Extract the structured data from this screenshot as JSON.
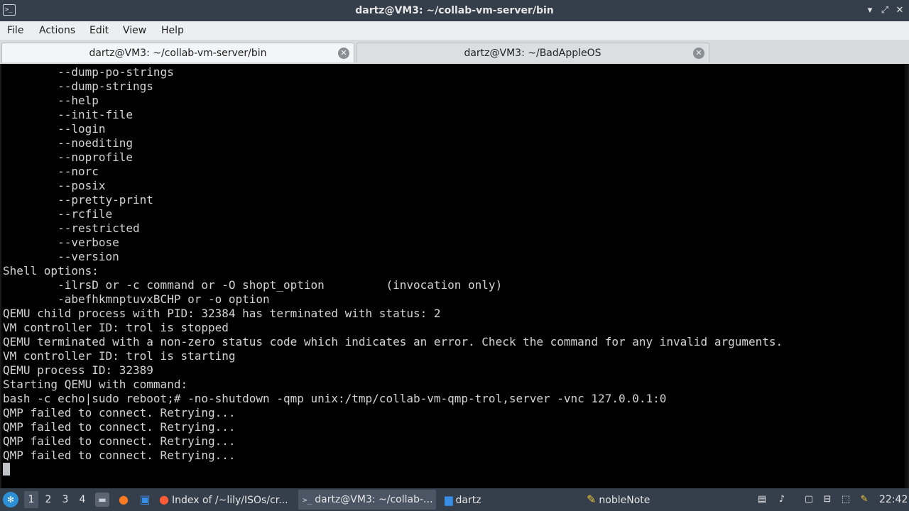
{
  "window": {
    "title": "dartz@VM3: ~/collab-vm-server/bin",
    "minimize_glyph": "▾",
    "maximize_glyph": "⤢",
    "close_glyph": "✕",
    "app_icon_glyph": ">_"
  },
  "menu": [
    "File",
    "Actions",
    "Edit",
    "View",
    "Help"
  ],
  "tabs": [
    {
      "label": "dartz@VM3: ~/collab-vm-server/bin",
      "close_glyph": "✕"
    },
    {
      "label": "dartz@VM3: ~/BadAppleOS",
      "close_glyph": "✕"
    }
  ],
  "terminal": {
    "lines": [
      "        --dump-po-strings",
      "        --dump-strings",
      "        --help",
      "        --init-file",
      "        --login",
      "        --noediting",
      "        --noprofile",
      "        --norc",
      "        --posix",
      "        --pretty-print",
      "        --rcfile",
      "        --restricted",
      "        --verbose",
      "        --version",
      "Shell options:",
      "        -ilrsD or -c command or -O shopt_option         (invocation only)",
      "        -abefhkmnptuvxBCHP or -o option",
      "QEMU child process with PID: 32384 has terminated with status: 2",
      "VM controller ID: trol is stopped",
      "QEMU terminated with a non-zero status code which indicates an error. Check the command for any invalid arguments.",
      "VM controller ID: trol is starting",
      "QEMU process ID: 32389",
      "Starting QEMU with command:",
      "bash -c echo|sudo reboot;# -no-shutdown -qmp unix:/tmp/collab-vm-qmp-trol,server -vnc 127.0.0.1:0",
      "QMP failed to connect. Retrying...",
      "QMP failed to connect. Retrying...",
      "QMP failed to connect. Retrying...",
      "QMP failed to connect. Retrying..."
    ]
  },
  "taskbar": {
    "start_glyph": "✻",
    "workspaces": [
      "1",
      "2",
      "3",
      "4"
    ],
    "launchers": [
      {
        "name": "desktop",
        "glyph": "▬",
        "color": "#c9cfd6"
      },
      {
        "name": "firefox",
        "glyph": "●",
        "color": "#ff7b22"
      },
      {
        "name": "window",
        "glyph": "▣",
        "color": "#3a8ee6"
      }
    ],
    "tasks": [
      {
        "label": "Index of /~lily/ISOs/cr...",
        "glyph": "●",
        "color": "#ff5c35"
      },
      {
        "label": "dartz@VM3: ~/collab-...",
        "glyph": ">_",
        "color": "#c9cfd6"
      },
      {
        "label": "dartz",
        "glyph": "▆",
        "color": "#3a8ee6"
      },
      {
        "label": "nobleNote",
        "glyph": "✎",
        "color": "#f0c93a"
      }
    ],
    "tray": [
      {
        "name": "keyboard",
        "glyph": "▤"
      },
      {
        "name": "volume",
        "glyph": "♪"
      },
      {
        "name": "clipboard",
        "glyph": "▢"
      },
      {
        "name": "network",
        "glyph": "⊟"
      },
      {
        "name": "bluetooth",
        "glyph": "⬚"
      },
      {
        "name": "notes",
        "glyph": "✎"
      }
    ],
    "clock": "22:42"
  }
}
